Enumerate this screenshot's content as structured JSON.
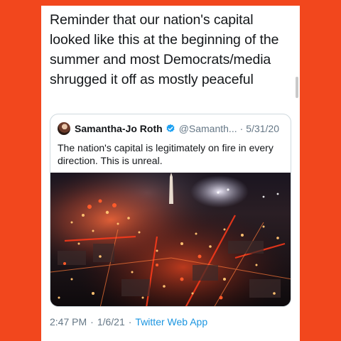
{
  "tweet": {
    "text": "Reminder that our nation's capital looked like this at the beginning of the summer and most Democrats/media shrugged it off as mostly peaceful",
    "time": "2:47 PM",
    "date": "1/6/21",
    "source": "Twitter Web App"
  },
  "quoted_tweet": {
    "name": "Samantha-Jo Roth",
    "handle": "@Samanth...",
    "separator": "·",
    "date": "5/31/20",
    "text": "The nation's capital is legitimately on fire in every direction. This is unreal.",
    "image_icon": "aerial-night-city-fire-photo"
  },
  "colors": {
    "page_background": "#f2471d",
    "card_background": "#ffffff",
    "link": "#1b95e0",
    "verified": "#1da1f2",
    "muted_text": "#657786"
  }
}
